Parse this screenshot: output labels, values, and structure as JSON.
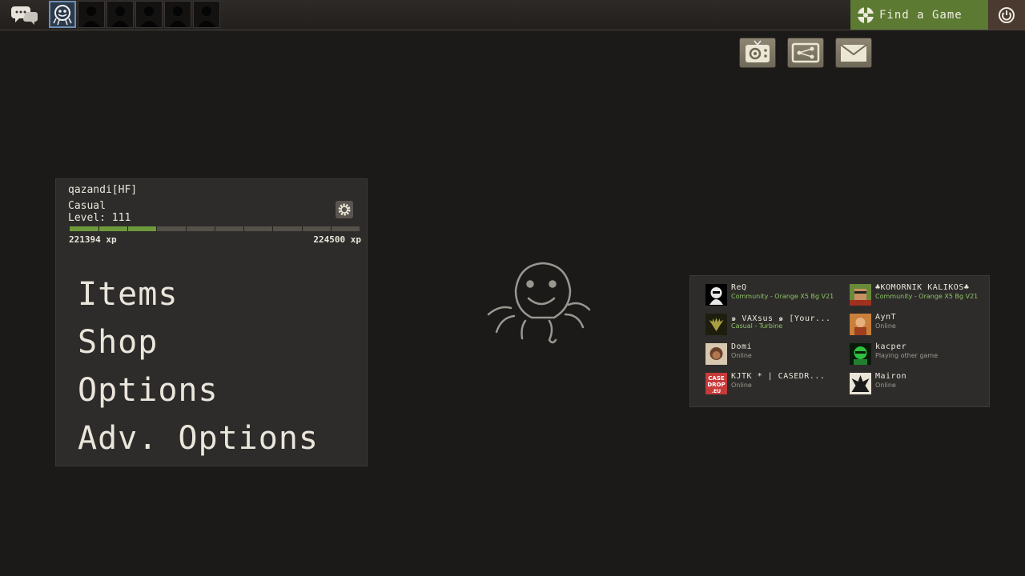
{
  "topbar": {
    "chat_icon": "chat-bubbles-icon",
    "party_slots": 6,
    "find_game_label": "Find a Game",
    "find_game_icon": "team-logo-icon",
    "power_icon": "power-icon"
  },
  "tools": [
    {
      "name": "tv-icon"
    },
    {
      "name": "workshop-icon"
    },
    {
      "name": "mail-icon"
    }
  ],
  "profile": {
    "name": "qazandi[HF]",
    "mode": "Casual",
    "level_label": "Level: 111",
    "xp_current": "221394 xp",
    "xp_next": "224500 xp",
    "xp_progress": 0.3
  },
  "menu": {
    "items": [
      "Items",
      "Shop",
      "Options",
      "Adv. Options"
    ]
  },
  "friends": [
    {
      "name": "ReQ",
      "status": "Community - Orange X5 Bg V21",
      "status_type": "green",
      "avatar_color": "#e8e8e8"
    },
    {
      "name": "♣KOMORNIK KALIKOS♣",
      "status": "Community - Orange X5 Bg V21",
      "status_type": "green",
      "avatar_color": "#6a8a3a"
    },
    {
      "name": "๑ VAXsus ๑ [Your...",
      "status": "Casual - Turbine",
      "status_type": "green",
      "avatar_color": "#4a4a1e"
    },
    {
      "name": "AynT",
      "status": "Online",
      "status_type": "gray",
      "avatar_color": "#c8803a"
    },
    {
      "name": "Domi",
      "status": "Online",
      "status_type": "gray",
      "avatar_color": "#8a5a3a"
    },
    {
      "name": "kacper",
      "status": "Playing other game",
      "status_type": "gray",
      "avatar_color": "#2a8a3a"
    },
    {
      "name": "KJTK * | CASEDR...",
      "status": "Online",
      "status_type": "gray",
      "avatar_color": "#c83a3a",
      "avatar_text": "CASE DROP .EU"
    },
    {
      "name": "Mairon",
      "status": "Online",
      "status_type": "gray",
      "avatar_color": "#d8d0c0"
    }
  ]
}
